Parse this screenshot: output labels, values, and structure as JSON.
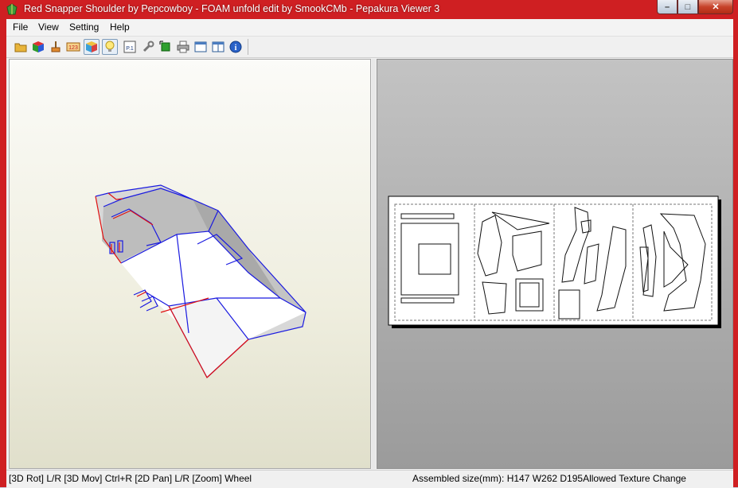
{
  "window": {
    "title": "Red Snapper Shoulder by Pepcowboy - FOAM unfold edit by SmookCMb - Pepakura Viewer 3",
    "controls": {
      "minimize": "–",
      "maximize": "□",
      "close": "✕"
    }
  },
  "menu": {
    "items": [
      "File",
      "View",
      "Setting",
      "Help"
    ]
  },
  "toolbar": {
    "buttons": [
      {
        "icon": "open-folder-icon"
      },
      {
        "icon": "color-cube-icon"
      },
      {
        "icon": "brush-icon"
      },
      {
        "icon": "numbers-icon"
      },
      {
        "icon": "texture-cube-icon",
        "active": true
      },
      {
        "icon": "light-bulb-icon",
        "active": true
      },
      {
        "icon": "page-number-icon",
        "label": "P.1"
      },
      {
        "icon": "wrench-icon"
      },
      {
        "icon": "piece-select-icon"
      },
      {
        "icon": "printer-icon"
      },
      {
        "icon": "single-pane-icon"
      },
      {
        "icon": "dual-pane-icon"
      },
      {
        "icon": "info-icon"
      }
    ]
  },
  "status": {
    "left": "[3D Rot] L/R [3D Mov] Ctrl+R [2D Pan] L/R [Zoom] Wheel",
    "right": "Assembled size(mm): H147 W262 D195Allowed Texture Change"
  },
  "colors": {
    "title_bar": "#cf1f22",
    "edge_red": "#e01010",
    "edge_blue": "#1a1ae0"
  }
}
